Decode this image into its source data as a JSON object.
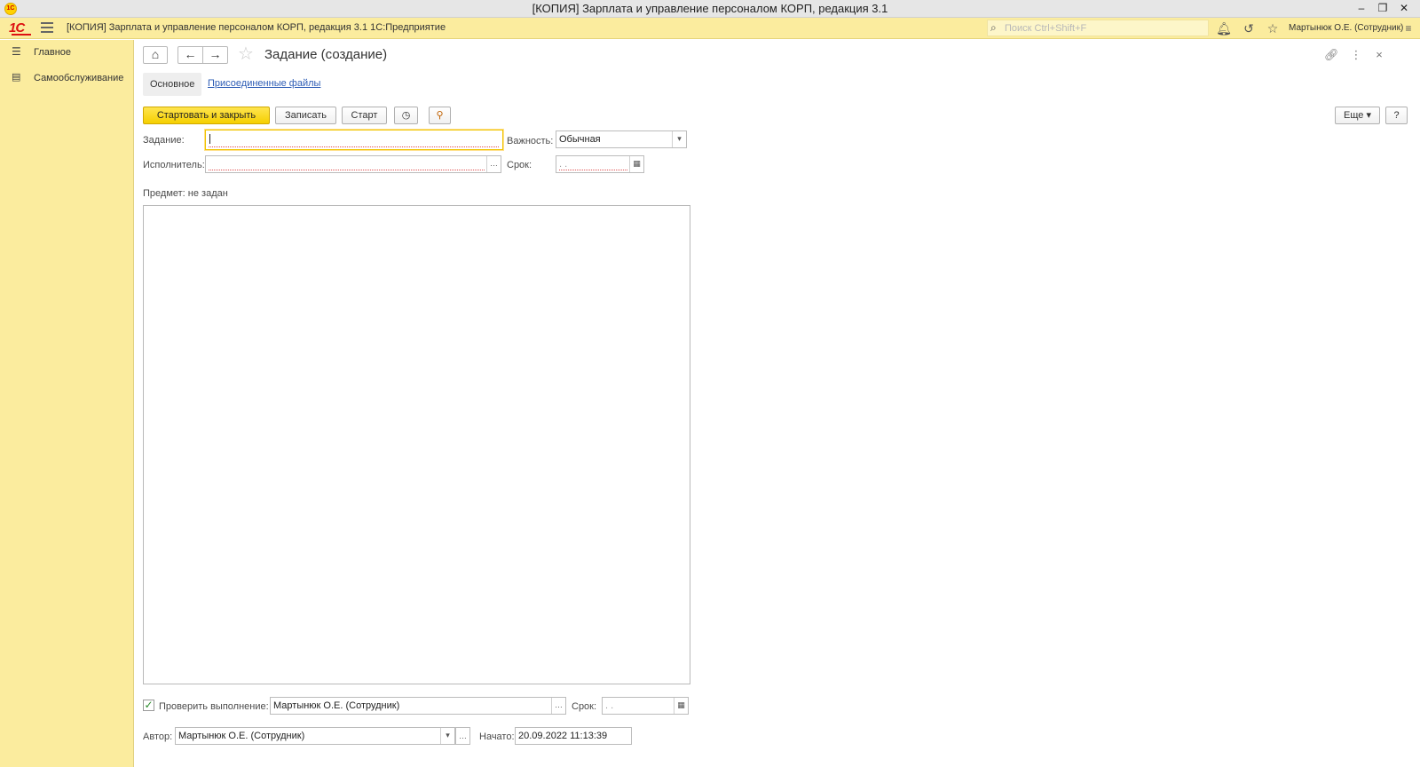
{
  "window": {
    "title": "[КОПИЯ] Зарплата и управление персоналом КОРП, редакция 3.1",
    "minimize": "–",
    "restore": "❐",
    "close": "✕"
  },
  "header": {
    "logo_text": "1С",
    "title": "[КОПИЯ] Зарплата и управление персоналом КОРП, редакция 3.1 1С:Предприятие",
    "search_placeholder": "Поиск Ctrl+Shift+F",
    "user": "Мартынюк О.Е. (Сотрудник)"
  },
  "sidebar": {
    "items": [
      {
        "label": "Главное",
        "icon": "menu-icon"
      },
      {
        "label": "Самообслуживание",
        "icon": "id-card-icon"
      }
    ]
  },
  "form": {
    "title": "Задание (создание)",
    "tabs": {
      "main": "Основное",
      "files": "Присоединенные файлы"
    },
    "toolbar": {
      "start_close": "Стартовать и закрыть",
      "save": "Записать",
      "start": "Старт",
      "more": "Еще",
      "help": "?"
    },
    "fields": {
      "task_label": "Задание:",
      "task_value": "",
      "importance_label": "Важность:",
      "importance_value": "Обычная",
      "performer_label": "Исполнитель:",
      "performer_value": "",
      "deadline_label": "Срок:",
      "deadline_value": " .  .",
      "subject_label": "Предмет:",
      "subject_value": "не задан",
      "check_label": "Проверить выполнение:",
      "check_checked": true,
      "check_value": "Мартынюк О.Е. (Сотрудник)",
      "check_deadline_label": "Срок:",
      "check_deadline_value": " .  .",
      "author_label": "Автор:",
      "author_value": "Мартынюк О.Е. (Сотрудник)",
      "started_label": "Начато:",
      "started_value": "20.09.2022 11:13:39"
    }
  }
}
